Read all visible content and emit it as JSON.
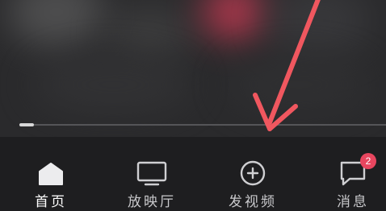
{
  "feed": {
    "progress_fraction": 0.04
  },
  "bottom_nav": {
    "items": [
      {
        "label": "首页",
        "icon": "home-icon",
        "active": true
      },
      {
        "label": "放映厅",
        "icon": "tv-icon",
        "active": false
      },
      {
        "label": "发视频",
        "icon": "plus-circle-icon",
        "active": false
      },
      {
        "label": "消息",
        "icon": "message-icon",
        "active": false,
        "badge": "2"
      }
    ]
  },
  "colors": {
    "background": "#1e1e20",
    "label": "#c9c9cc",
    "active_label": "#ffffff",
    "badge": "#e8465f",
    "annotation_arrow": "#f0575f"
  }
}
